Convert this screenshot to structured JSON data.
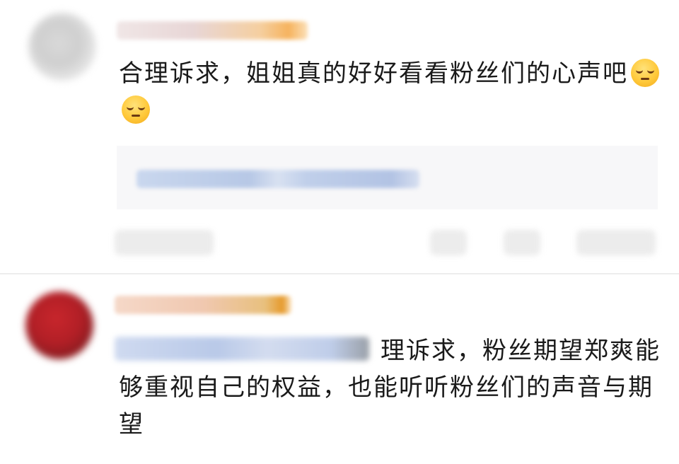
{
  "comments": [
    {
      "text": "合理诉求，姐姐真的好好看看粉丝们的心声吧",
      "emojis": [
        "pensive-face",
        "pensive-face"
      ]
    },
    {
      "text": "理诉求，粉丝期望郑爽能够重视自己的权益，也能听听粉丝们的声音与期望"
    }
  ],
  "colors": {
    "text": "#1a1a1a",
    "quote_bg": "#f7f7f9",
    "background": "#ffffff"
  }
}
